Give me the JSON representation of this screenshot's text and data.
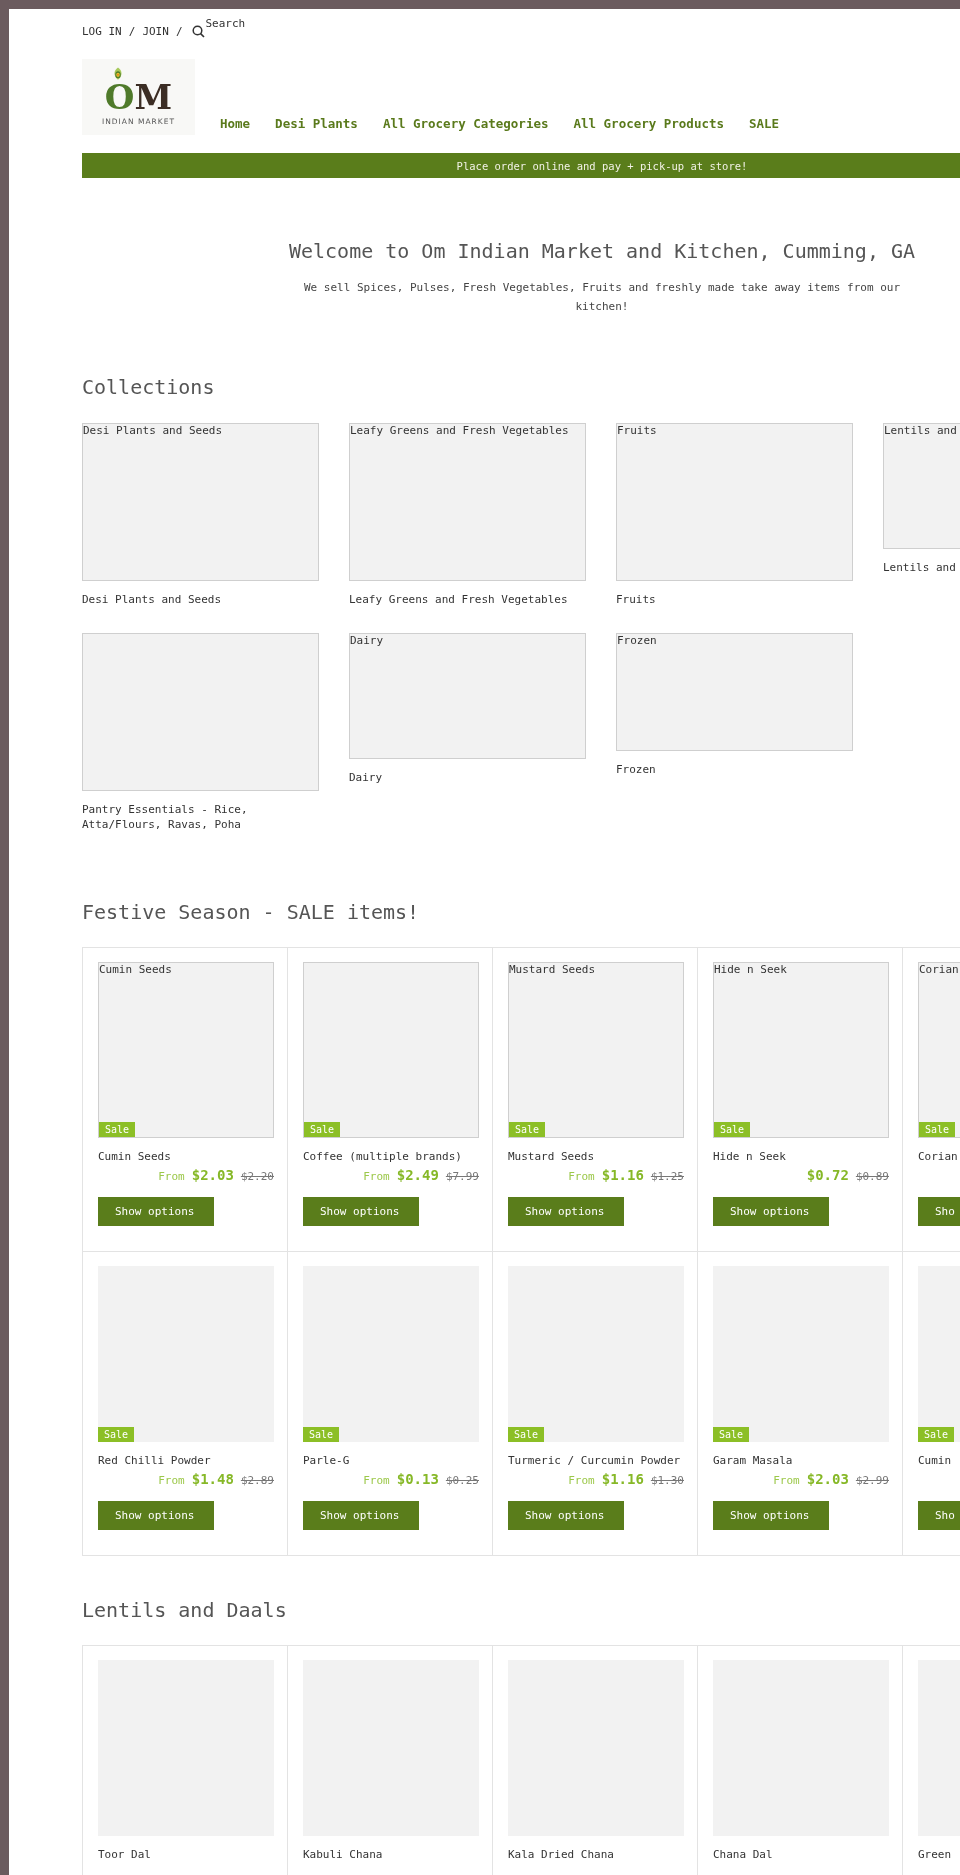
{
  "top_links": [
    "LOG IN",
    "/",
    "JOIN",
    "/"
  ],
  "search": {
    "label": "Search"
  },
  "logo": {
    "mark_left": "O",
    "mark_right": "M",
    "tagline": "INDIAN MARKET"
  },
  "nav": [
    {
      "label": "Home"
    },
    {
      "label": "Desi Plants"
    },
    {
      "label": "All Grocery Categories"
    },
    {
      "label": "All Grocery Products"
    },
    {
      "label": "SALE"
    }
  ],
  "announcement": "Place order online and pay + pick-up at store!",
  "hero": {
    "title": "Welcome to Om Indian Market and Kitchen, Cumming, GA",
    "text": "We sell Spices, Pulses, Fresh Vegetables, Fruits and freshly made take away items from our kitchen!"
  },
  "collections": {
    "title": "Collections",
    "items": [
      {
        "alt": "Desi Plants and Seeds",
        "label": "Desi Plants and Seeds",
        "kind": "tall"
      },
      {
        "alt": "Leafy Greens and Fresh Vegetables",
        "label": "Leafy Greens and Fresh Vegetables",
        "kind": "tall"
      },
      {
        "alt": "Fruits",
        "label": "Fruits",
        "kind": "tall"
      },
      {
        "alt": "Lentils and",
        "label": "Lentils and",
        "kind": "wide"
      },
      {
        "label": "Pantry Essentials - Rice, Atta/Flours, Ravas, Poha",
        "kind": "tall"
      },
      {
        "alt": "Dairy",
        "label": "Dairy",
        "kind": "wide"
      },
      {
        "alt": "Frozen",
        "label": "Frozen",
        "kind": "wider"
      }
    ]
  },
  "sale_section": {
    "title": "Festive Season - SALE items!",
    "products": [
      {
        "alt": "Cumin Seeds",
        "broken": true,
        "badge": "Sale",
        "name": "Cumin Seeds",
        "from": "From",
        "price": "$2.03",
        "compare_at": "$2.20",
        "button": "Show options"
      },
      {
        "broken": true,
        "badge": "Sale",
        "name": "Coffee (multiple brands)",
        "from": "From",
        "price": "$2.49",
        "compare_at": "$7.99",
        "button": "Show options"
      },
      {
        "alt": "Mustard Seeds",
        "broken": true,
        "badge": "Sale",
        "name": "Mustard Seeds",
        "from": "From",
        "price": "$1.16",
        "compare_at": "$1.25",
        "button": "Show options"
      },
      {
        "alt": "Hide n Seek",
        "broken": true,
        "badge": "Sale",
        "name": "Hide n Seek",
        "price": "$0.72",
        "compare_at": "$0.89",
        "button": "Show options"
      },
      {
        "alt": "Corian",
        "broken": true,
        "badge": "Sale",
        "name": "Corian",
        "button": "Sho"
      },
      {
        "broken": false,
        "badge": "Sale",
        "name": "Red Chilli Powder",
        "from": "From",
        "price": "$1.48",
        "compare_at": "$2.89",
        "button": "Show options"
      },
      {
        "broken": false,
        "badge": "Sale",
        "name": "Parle-G",
        "from": "From",
        "price": "$0.13",
        "compare_at": "$0.25",
        "button": "Show options"
      },
      {
        "broken": false,
        "badge": "Sale",
        "name": "Turmeric / Curcumin Powder",
        "from": "From",
        "price": "$1.16",
        "compare_at": "$1.30",
        "button": "Show options"
      },
      {
        "broken": false,
        "badge": "Sale",
        "name": "Garam Masala",
        "from": "From",
        "price": "$2.03",
        "compare_at": "$2.99",
        "button": "Show options"
      },
      {
        "broken": false,
        "badge": "Sale",
        "name": "Cumin",
        "button": "Sho"
      }
    ]
  },
  "lentils_section": {
    "title": "Lentils and Daals",
    "products": [
      {
        "broken": false,
        "name": "Toor Dal"
      },
      {
        "broken": false,
        "name": "Kabuli Chana"
      },
      {
        "broken": false,
        "name": "Kala Dried Chana"
      },
      {
        "broken": false,
        "name": "Chana Dal"
      },
      {
        "broken": false,
        "name": "Green"
      }
    ]
  }
}
